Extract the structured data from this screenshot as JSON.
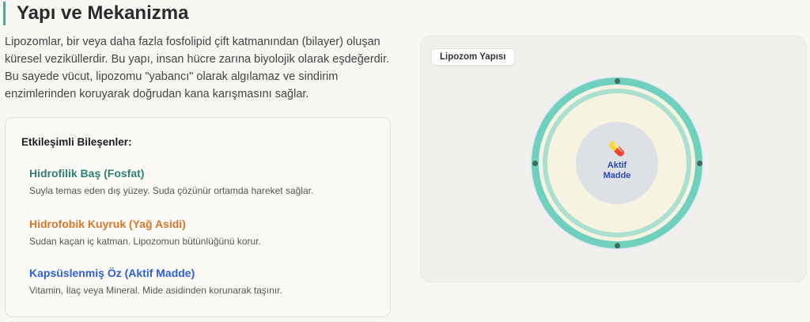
{
  "page": {
    "title": "Yapı ve Mekanizma",
    "intro": "Lipozomlar, bir veya daha fazla fosfolipid çift katmanından (bilayer) oluşan küresel veziküllerdir. Bu yapı, insan hücre zarına biyolojik olarak eşdeğerdir. Bu sayede vücut, lipozomu \"yabancı\" olarak algılamaz ve sindirim enzimlerinden koruyarak doğrudan kana karışmasını sağlar."
  },
  "components": {
    "title": "Etkileşimli Bileşenler:",
    "items": [
      {
        "name": "Hidrofilik Baş (Fosfat)",
        "description": "Suyla temas eden dış yüzey. Suda çözünür ortamda hareket sağlar.",
        "color": "#2f7f73"
      },
      {
        "name": "Hidrofobik Kuyruk (Yağ Asidi)",
        "description": "Sudan kaçan iç katman. Lipozomun bütünlüğünü korur.",
        "color": "#d9772a"
      },
      {
        "name": "Kapsüslenmiş Öz (Aktif Madde)",
        "description": "Vitamin, İlaç veya Mineral. Mide asidinden korunarak taşınır.",
        "color": "#2f5fd6"
      }
    ]
  },
  "visualization": {
    "label": "Lipozom Yapısı",
    "core_icon": "pill-icon",
    "core_glyph": "💊",
    "core_label": "Aktif Madde",
    "colors": {
      "outer_ring": "#6ed0bd",
      "inner_ring": "#abdfcf",
      "interior": "#f7f3e1",
      "core": "#dde1e6",
      "nodes": "#3f6b5b",
      "core_text": "#2b48b6"
    }
  }
}
